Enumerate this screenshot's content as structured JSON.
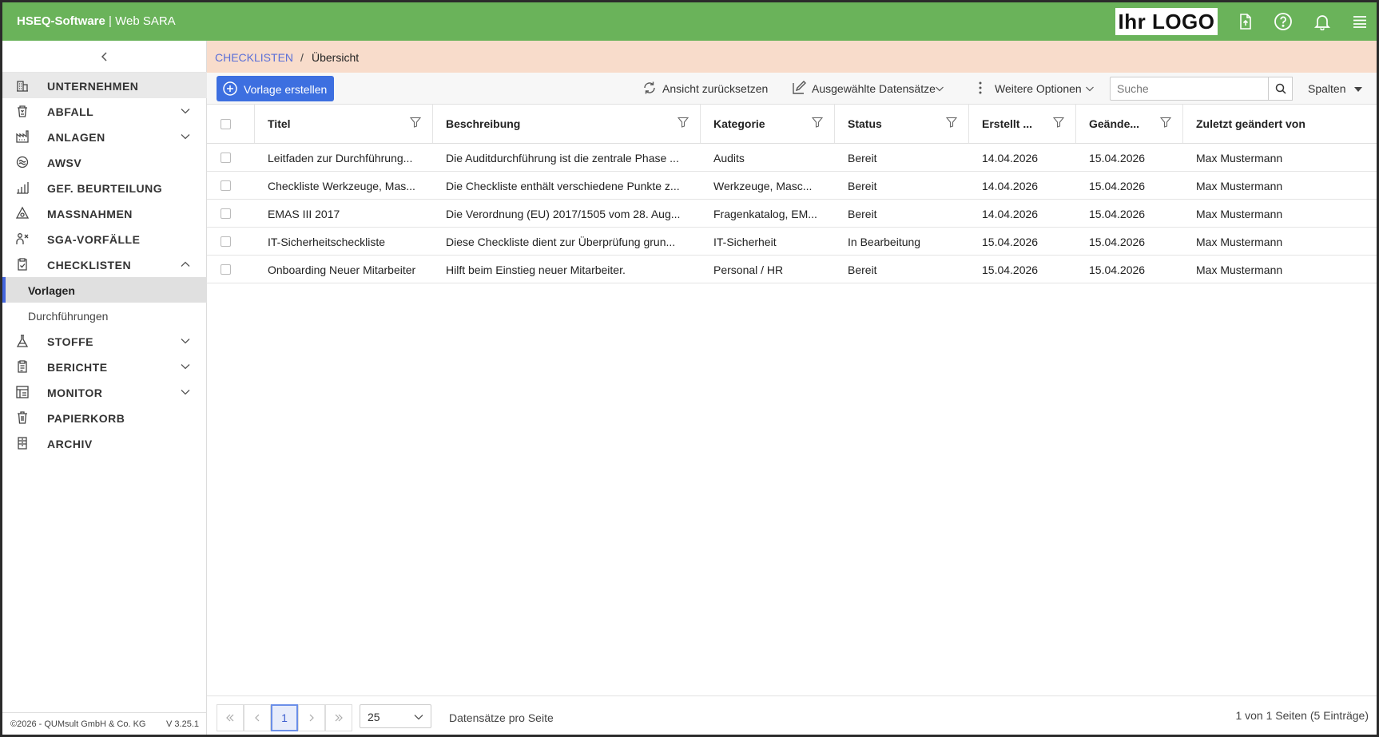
{
  "app": {
    "brand_bold": "HSEQ-Software",
    "brand_sep": " | ",
    "brand_rest": "Web SARA",
    "logo": "Ihr LOGO"
  },
  "topbar_icons": [
    "file-upload-icon",
    "help-icon",
    "bell-icon",
    "menu-icon"
  ],
  "colors": {
    "topbar": "#6ab35a",
    "breadcrumb_bg": "#f8dccb",
    "primary": "#3d6fe0",
    "selected_indicator": "#4466dd"
  },
  "sidebar": {
    "collapse_icon": "chevron-left-icon",
    "items": [
      {
        "label": "UNTERNEHMEN",
        "icon": "building-icon",
        "expandable": false
      },
      {
        "label": "ABFALL",
        "icon": "waste-icon",
        "expandable": true
      },
      {
        "label": "ANLAGEN",
        "icon": "factory-icon",
        "expandable": true
      },
      {
        "label": "AWSV",
        "icon": "water-icon",
        "expandable": false
      },
      {
        "label": "GEF. BEURTEILUNG",
        "icon": "chart-icon",
        "expandable": false
      },
      {
        "label": "MASSNAHMEN",
        "icon": "measures-icon",
        "expandable": false
      },
      {
        "label": "SGA-VORFÄLLE",
        "icon": "incident-icon",
        "expandable": false
      },
      {
        "label": "CHECKLISTEN",
        "icon": "clipboard-check-icon",
        "expandable": true,
        "expanded": true
      },
      {
        "label": "STOFFE",
        "icon": "flask-icon",
        "expandable": true
      },
      {
        "label": "BERICHTE",
        "icon": "report-icon",
        "expandable": true
      },
      {
        "label": "MONITOR",
        "icon": "monitor-icon",
        "expandable": true
      },
      {
        "label": "PAPIERKORB",
        "icon": "trash-icon",
        "expandable": false
      },
      {
        "label": "ARCHIV",
        "icon": "archive-icon",
        "expandable": false
      }
    ],
    "sub_items": [
      {
        "label": "Vorlagen",
        "selected": true
      },
      {
        "label": "Durchführungen",
        "selected": false
      }
    ],
    "footer": {
      "copyright": "©2026 - QUMsult GmbH & Co. KG",
      "version": "V 3.25.1"
    }
  },
  "breadcrumb": {
    "link": "CHECKLISTEN",
    "separator": "/",
    "current": "Übersicht"
  },
  "toolbar": {
    "create_label": "Vorlage erstellen",
    "reset_label": "Ansicht zurücksetzen",
    "selected_label": "Ausgewählte Datensätze",
    "more_label": "Weitere Optionen",
    "search_placeholder": "Suche",
    "columns_label": "Spalten"
  },
  "table": {
    "columns": [
      "Titel",
      "Beschreibung",
      "Kategorie",
      "Status",
      "Erstellt ...",
      "Geände...",
      "Zuletzt geändert von"
    ],
    "rows": [
      [
        "Leitfaden zur Durchführung...",
        "Die Auditdurchführung ist die zentrale Phase ...",
        "Audits",
        "Bereit",
        "14.04.2026",
        "15.04.2026",
        "Max Mustermann"
      ],
      [
        "Checkliste Werkzeuge, Mas...",
        "Die Checkliste enthält verschiedene Punkte z...",
        "Werkzeuge, Masc...",
        "Bereit",
        "14.04.2026",
        "15.04.2026",
        "Max Mustermann"
      ],
      [
        "EMAS III 2017",
        "Die Verordnung (EU) 2017/1505 vom 28. Aug...",
        "Fragenkatalog, EM...",
        "Bereit",
        "14.04.2026",
        "15.04.2026",
        "Max Mustermann"
      ],
      [
        "IT-Sicherheitscheckliste",
        "Diese Checkliste dient zur Überprüfung grun...",
        "IT-Sicherheit",
        "In Bearbeitung",
        "15.04.2026",
        "15.04.2026",
        "Max Mustermann"
      ],
      [
        "Onboarding Neuer Mitarbeiter",
        "Hilft beim Einstieg neuer Mitarbeiter.",
        "Personal / HR",
        "Bereit",
        "15.04.2026",
        "15.04.2026",
        "Max Mustermann"
      ]
    ]
  },
  "pager": {
    "current_page": "1",
    "page_size": "25",
    "per_page_label": "Datensätze pro Seite",
    "info": "1 von 1 Seiten (5 Einträge)"
  }
}
